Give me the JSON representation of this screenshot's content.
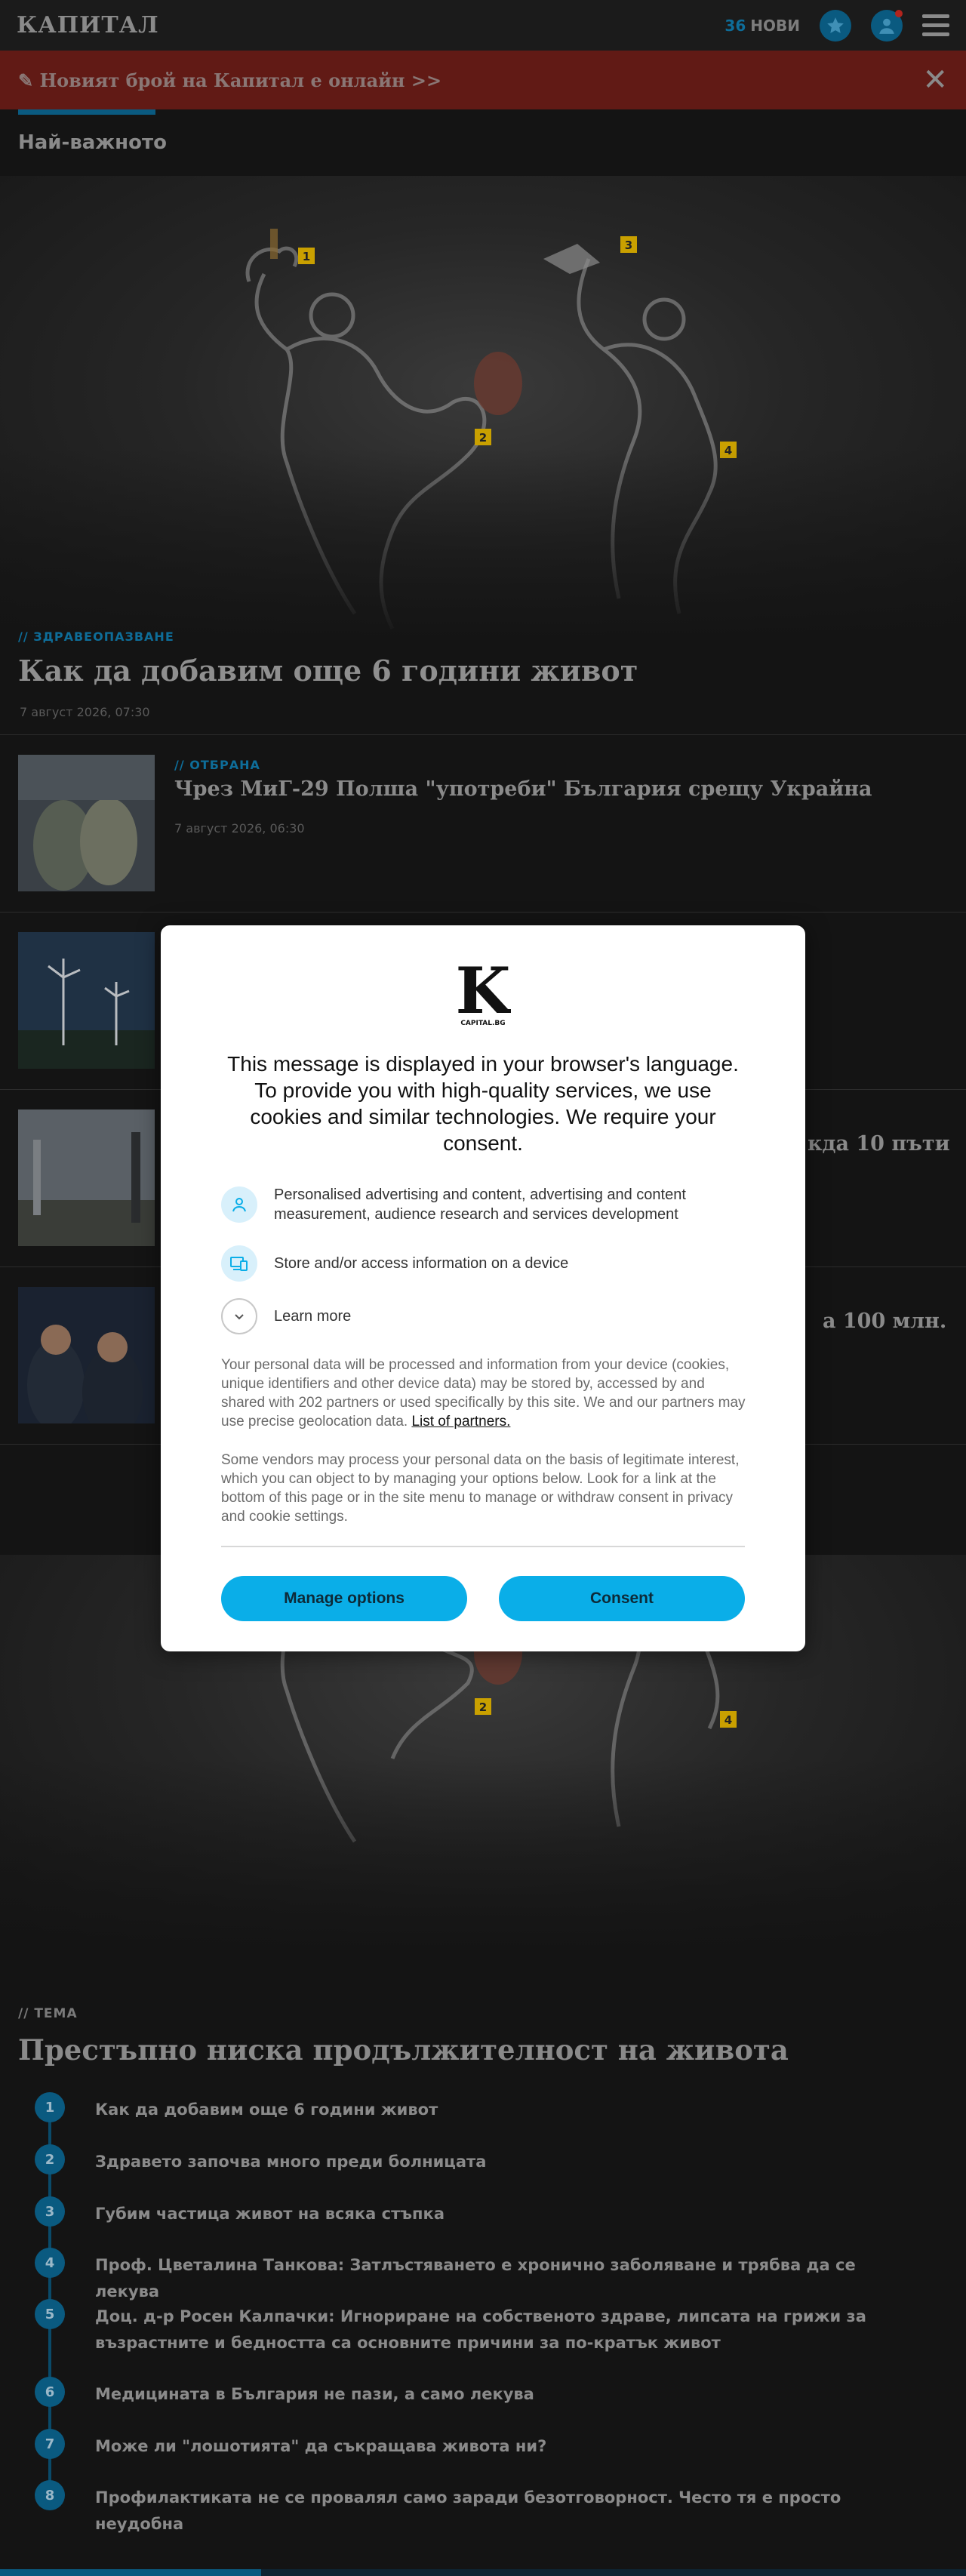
{
  "header": {
    "logo": "КАПИТАЛ",
    "new_count": "36",
    "new_label": "НОВИ"
  },
  "banner": {
    "text": "✎ Новият брой на Капитал е онлайн >>",
    "close": "✕"
  },
  "section": {
    "title": "Най-важното"
  },
  "hero": {
    "category": "// ЗДРАВЕОПАЗВАНЕ",
    "title": "Как да добавим още 6 години живот",
    "date": "7 август 2026, 07:30",
    "markers": [
      "1",
      "2",
      "3",
      "4"
    ]
  },
  "articles": [
    {
      "category": "// ОТБРАНА",
      "title": "Чрез МиГ-29 Полша \"употреби\" България срещу Украйна",
      "date": "7 август 2026, 06:30"
    },
    {
      "category": "",
      "title": "",
      "date": ""
    },
    {
      "category": "",
      "title": "кда 10 пъти",
      "date": ""
    },
    {
      "category": "",
      "title": "а 100 млн.",
      "date": ""
    }
  ],
  "topic": {
    "label": "// ТЕМА",
    "title": "Престъпно ниска продължителност на живота",
    "items": [
      {
        "num": "1",
        "text": "Как да добавим още 6 години живот"
      },
      {
        "num": "2",
        "text": "Здравето започва много преди болницата"
      },
      {
        "num": "3",
        "text": "Губим частица живот на всяка стъпка"
      },
      {
        "num": "4",
        "text": "Проф. Цветалина Танкова: Затлъстяването е хронично заболяване и трябва да се лекува"
      },
      {
        "num": "5",
        "text": "Доц. д-р Росен Калпачки: Игнориране на собственото здраве, липсата на грижи за възрастните и бедността са основните причини за по-кратък живот"
      },
      {
        "num": "6",
        "text": "Медицината в България не пази, а само лекува"
      },
      {
        "num": "7",
        "text": "Може ли \"лошотията\" да съкращава живота ни?"
      },
      {
        "num": "8",
        "text": "Профилактиката не се провалял само заради безотговорност. Често тя е просто неудобна"
      }
    ],
    "reading_progress": 0.27
  },
  "consent": {
    "logo_letter": "K",
    "logo_caption": "CAPITAL.BG",
    "heading": "This message is displayed in your browser's language. To provide you with high-quality services, we use cookies and similar technologies. We require your consent.",
    "purposes": [
      {
        "icon": "person-icon",
        "text": "Personalised advertising and content, advertising and content measurement, audience research and services development"
      },
      {
        "icon": "devices-icon",
        "text": "Store and/or access information on a device"
      },
      {
        "icon": "chevron-down-icon",
        "text": "Learn more"
      }
    ],
    "para1": "Your personal data will be processed and information from your device (cookies, unique identifiers and other device data) may be stored by, accessed by and shared with 202 partners or used specifically by this site. We and our partners may use precise geolocation data.",
    "partners_link": "List of partners.",
    "para2": "Some vendors may process your personal data on the basis of legitimate interest, which you can object to by managing your options below. Look for a link at the bottom of this page or in the site menu to manage or withdraw consent in privacy and cookie settings.",
    "manage_label": "Manage options",
    "consent_label": "Consent"
  },
  "colors": {
    "accent": "#0aaee8",
    "brand_blue": "#0a5a80",
    "banner_red": "#611a15"
  }
}
